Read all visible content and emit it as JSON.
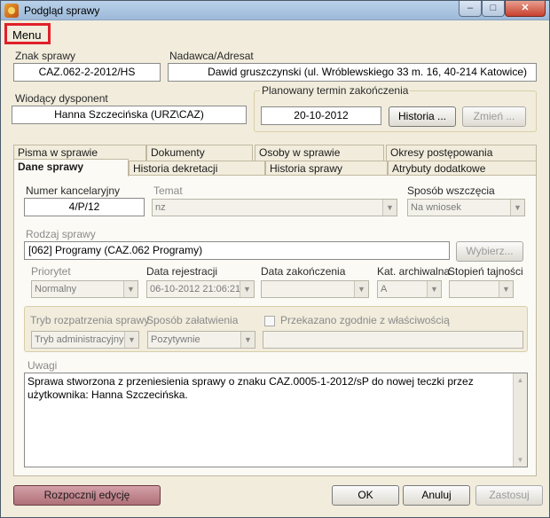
{
  "window": {
    "title": "Podgląd sprawy",
    "min": "–",
    "max": "□",
    "close": "✕"
  },
  "menubar": {
    "menu": "Menu"
  },
  "header": {
    "znak_label": "Znak sprawy",
    "znak_value": "CAZ.062-2-2012/HS",
    "nadawca_label": "Nadawca/Adresat",
    "nadawca_value": "Dawid gruszczynski (ul. Wróblewskiego 33 m. 16, 40-214 Katowice)",
    "dysponent_label": "Wiodący dysponent",
    "dysponent_value": "Hanna Szczecińska (URZ\\CAZ)",
    "termin_label": "Planowany termin zakończenia",
    "termin_value": "20-10-2012",
    "historia_btn": "Historia ...",
    "zmien_btn": "Zmień ..."
  },
  "tabs_row1": [
    "Pisma w sprawie",
    "Dokumenty",
    "Osoby w sprawie",
    "Okresy postępowania"
  ],
  "tabs_row2": [
    "Dane sprawy",
    "Historia dekretacji",
    "Historia sprawy",
    "Atrybuty dodatkowe"
  ],
  "form": {
    "numer_label": "Numer kancelaryjny",
    "numer_value": "4/P/12",
    "temat_label": "Temat",
    "temat_value": "nz",
    "sposob_label": "Sposób wszczęcia",
    "sposob_value": "Na wniosek",
    "rodzaj_label": "Rodzaj sprawy",
    "rodzaj_value": "[062] Programy (CAZ.062 Programy)",
    "wybierz_btn": "Wybierz...",
    "priorytet_label": "Priorytet",
    "priorytet_value": "Normalny",
    "data_rej_label": "Data rejestracji",
    "data_rej_value": "06-10-2012 21:06:21",
    "data_zak_label": "Data zakończenia",
    "data_zak_value": "",
    "kat_label": "Kat. archiwalna",
    "kat_value": "A",
    "stopien_label": "Stopień tajności",
    "stopien_value": "",
    "tryb_label": "Tryb rozpatrzenia sprawy",
    "tryb_value": "Tryb administracyjny",
    "zalatwienia_label": "Sposób załatwienia",
    "zalatwienia_value": "Pozytywnie",
    "przekazano_label": "Przekazano zgodnie z właściwością",
    "przekazano_value": "",
    "uwagi_label": "Uwagi",
    "uwagi_value": "Sprawa stworzona z przeniesienia sprawy o znaku CAZ.0005-1-2012/sP do nowej teczki przez użytkownika: Hanna Szczecińska."
  },
  "footer": {
    "rozpocznij": "Rozpocznij edycję",
    "ok": "OK",
    "anuluj": "Anuluj",
    "zastosuj": "Zastosuj"
  }
}
